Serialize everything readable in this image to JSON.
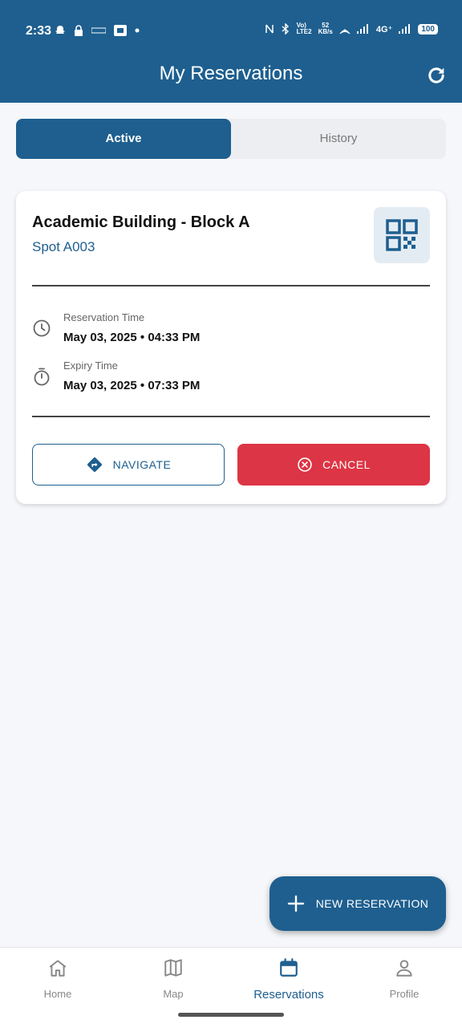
{
  "status_bar": {
    "time": "2:33",
    "network": "4G⁺",
    "speed_value": "52",
    "speed_unit": "KB/s",
    "battery": "100"
  },
  "app_bar": {
    "title": "My Reservations",
    "refresh_icon": "refresh-icon"
  },
  "tabs": [
    {
      "label": "Active",
      "selected": true
    },
    {
      "label": "History",
      "selected": false
    }
  ],
  "reservation": {
    "location": "Academic Building - Block A",
    "spot": "Spot A003",
    "reservation_time_label": "Reservation Time",
    "reservation_time_value": "May 03, 2025 • 04:33 PM",
    "expiry_time_label": "Expiry Time",
    "expiry_time_value": "May 03, 2025 • 07:33 PM",
    "navigate_label": "NAVIGATE",
    "cancel_label": "CANCEL"
  },
  "fab": {
    "label": "NEW RESERVATION"
  },
  "bottom_nav": [
    {
      "label": "Home",
      "icon": "home-icon"
    },
    {
      "label": "Map",
      "icon": "map-icon"
    },
    {
      "label": "Reservations",
      "icon": "calendar-icon",
      "active": true
    },
    {
      "label": "Profile",
      "icon": "person-icon"
    }
  ],
  "colors": {
    "primary": "#1e5f8f",
    "danger": "#dc3545",
    "background": "#f5f7fa"
  }
}
